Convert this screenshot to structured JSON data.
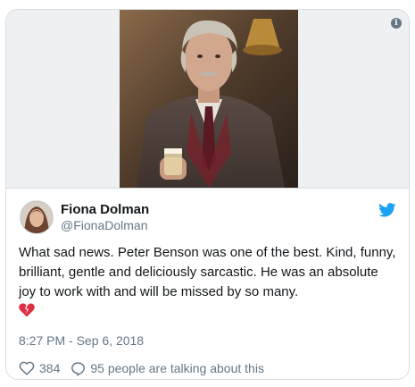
{
  "tweet": {
    "author_name": "Fiona Dolman",
    "author_handle": "@FionaDolman",
    "text": "What sad news. Peter Benson was one of the best. Kind, funny, brilliant, gentle and deliciously sarcastic. He was an absolute joy to work with and will be missed by so many.",
    "emoji": "broken-heart-icon",
    "timestamp": "8:27 PM - Sep 6, 2018",
    "like_count": "384",
    "talking_text": "95 people are talking about this"
  },
  "colors": {
    "twitter_blue": "#1da1f2",
    "secondary_text": "#657786",
    "border": "#d8dde2",
    "broken_heart": "#dd2e44"
  },
  "icons": {
    "info": "info-icon",
    "bird": "twitter-bird-icon",
    "like": "heart-outline-icon",
    "reply": "speech-bubble-icon"
  }
}
